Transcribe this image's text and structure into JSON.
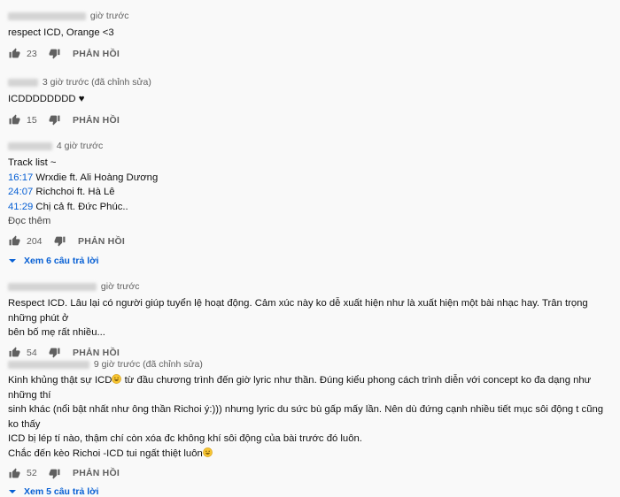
{
  "comments": [
    {
      "age": "giờ trước",
      "edited": "",
      "lines": [
        "respect ICD, Orange <3"
      ],
      "likes": "23",
      "reply_label": "PHẢN HỒI"
    },
    {
      "age": "3 giờ trước",
      "edited": "(đã chỉnh sửa)",
      "lines": [
        "ICDDDDDDDD ♥"
      ],
      "likes": "15",
      "reply_label": "PHẢN HỒI"
    },
    {
      "age": "4 giờ trước",
      "edited": "",
      "intro": "Track list ~",
      "tracks": [
        {
          "time": "16:17",
          "title": " Wrxdie ft. Ali Hoàng Dương"
        },
        {
          "time": "24:07",
          "title": " Richchoi ft. Hà Lê"
        },
        {
          "time": "41:29",
          "title": " Chị cả ft. Đức Phúc.."
        }
      ],
      "read_more": "Đọc thêm",
      "likes": "204",
      "reply_label": "PHẢN HỒI",
      "view_replies": "Xem 6 câu trả lời"
    },
    {
      "age": "giờ trước",
      "edited": "",
      "lines": [
        "Respect ICD. Lâu lại có người giúp tuyển lệ hoạt động. Cảm xúc này ko dễ xuất hiện như là xuất hiện một bài nhạc hay. Trân trọng những phút ở",
        "bên bố mẹ rất nhiều..."
      ],
      "likes": "54",
      "reply_label": "PHẢN HỒI"
    },
    {
      "age": "9 giờ trước",
      "edited": "(đã chỉnh sửa)",
      "line1": "Kinh khủng thật sự ICD",
      "line1_rest": " từ đầu chương trình đến giờ lyric như thần. Đúng kiểu phong cách trình diễn với concept ko đa dạng như những thí",
      "lines": [
        "sinh khác (nổi bật nhất như ông thần Richoi ý:))) nhưng lyric du sức bù gấp mấy lần. Nên dù đứng cạnh nhiều tiết mục sôi động t cũng ko thấy",
        "ICD bị lép tí nào, thậm chí còn xóa đc không khí sôi động của bài trước đó luôn."
      ],
      "last_line": "Chắc đến kèo Richoi -ICD tui ngất thiệt luôn",
      "likes": "52",
      "reply_label": "PHẢN HỒI",
      "view_replies": "Xem 5 câu trả lời"
    }
  ],
  "icons": {
    "like": "thumbs-up-icon",
    "dislike": "thumbs-down-icon",
    "expand": "chevron-down-icon",
    "emoji": "grinning-face-icon"
  },
  "colors": {
    "link": "#065fd4",
    "meta": "#606060",
    "background": "#f9f9f9"
  }
}
